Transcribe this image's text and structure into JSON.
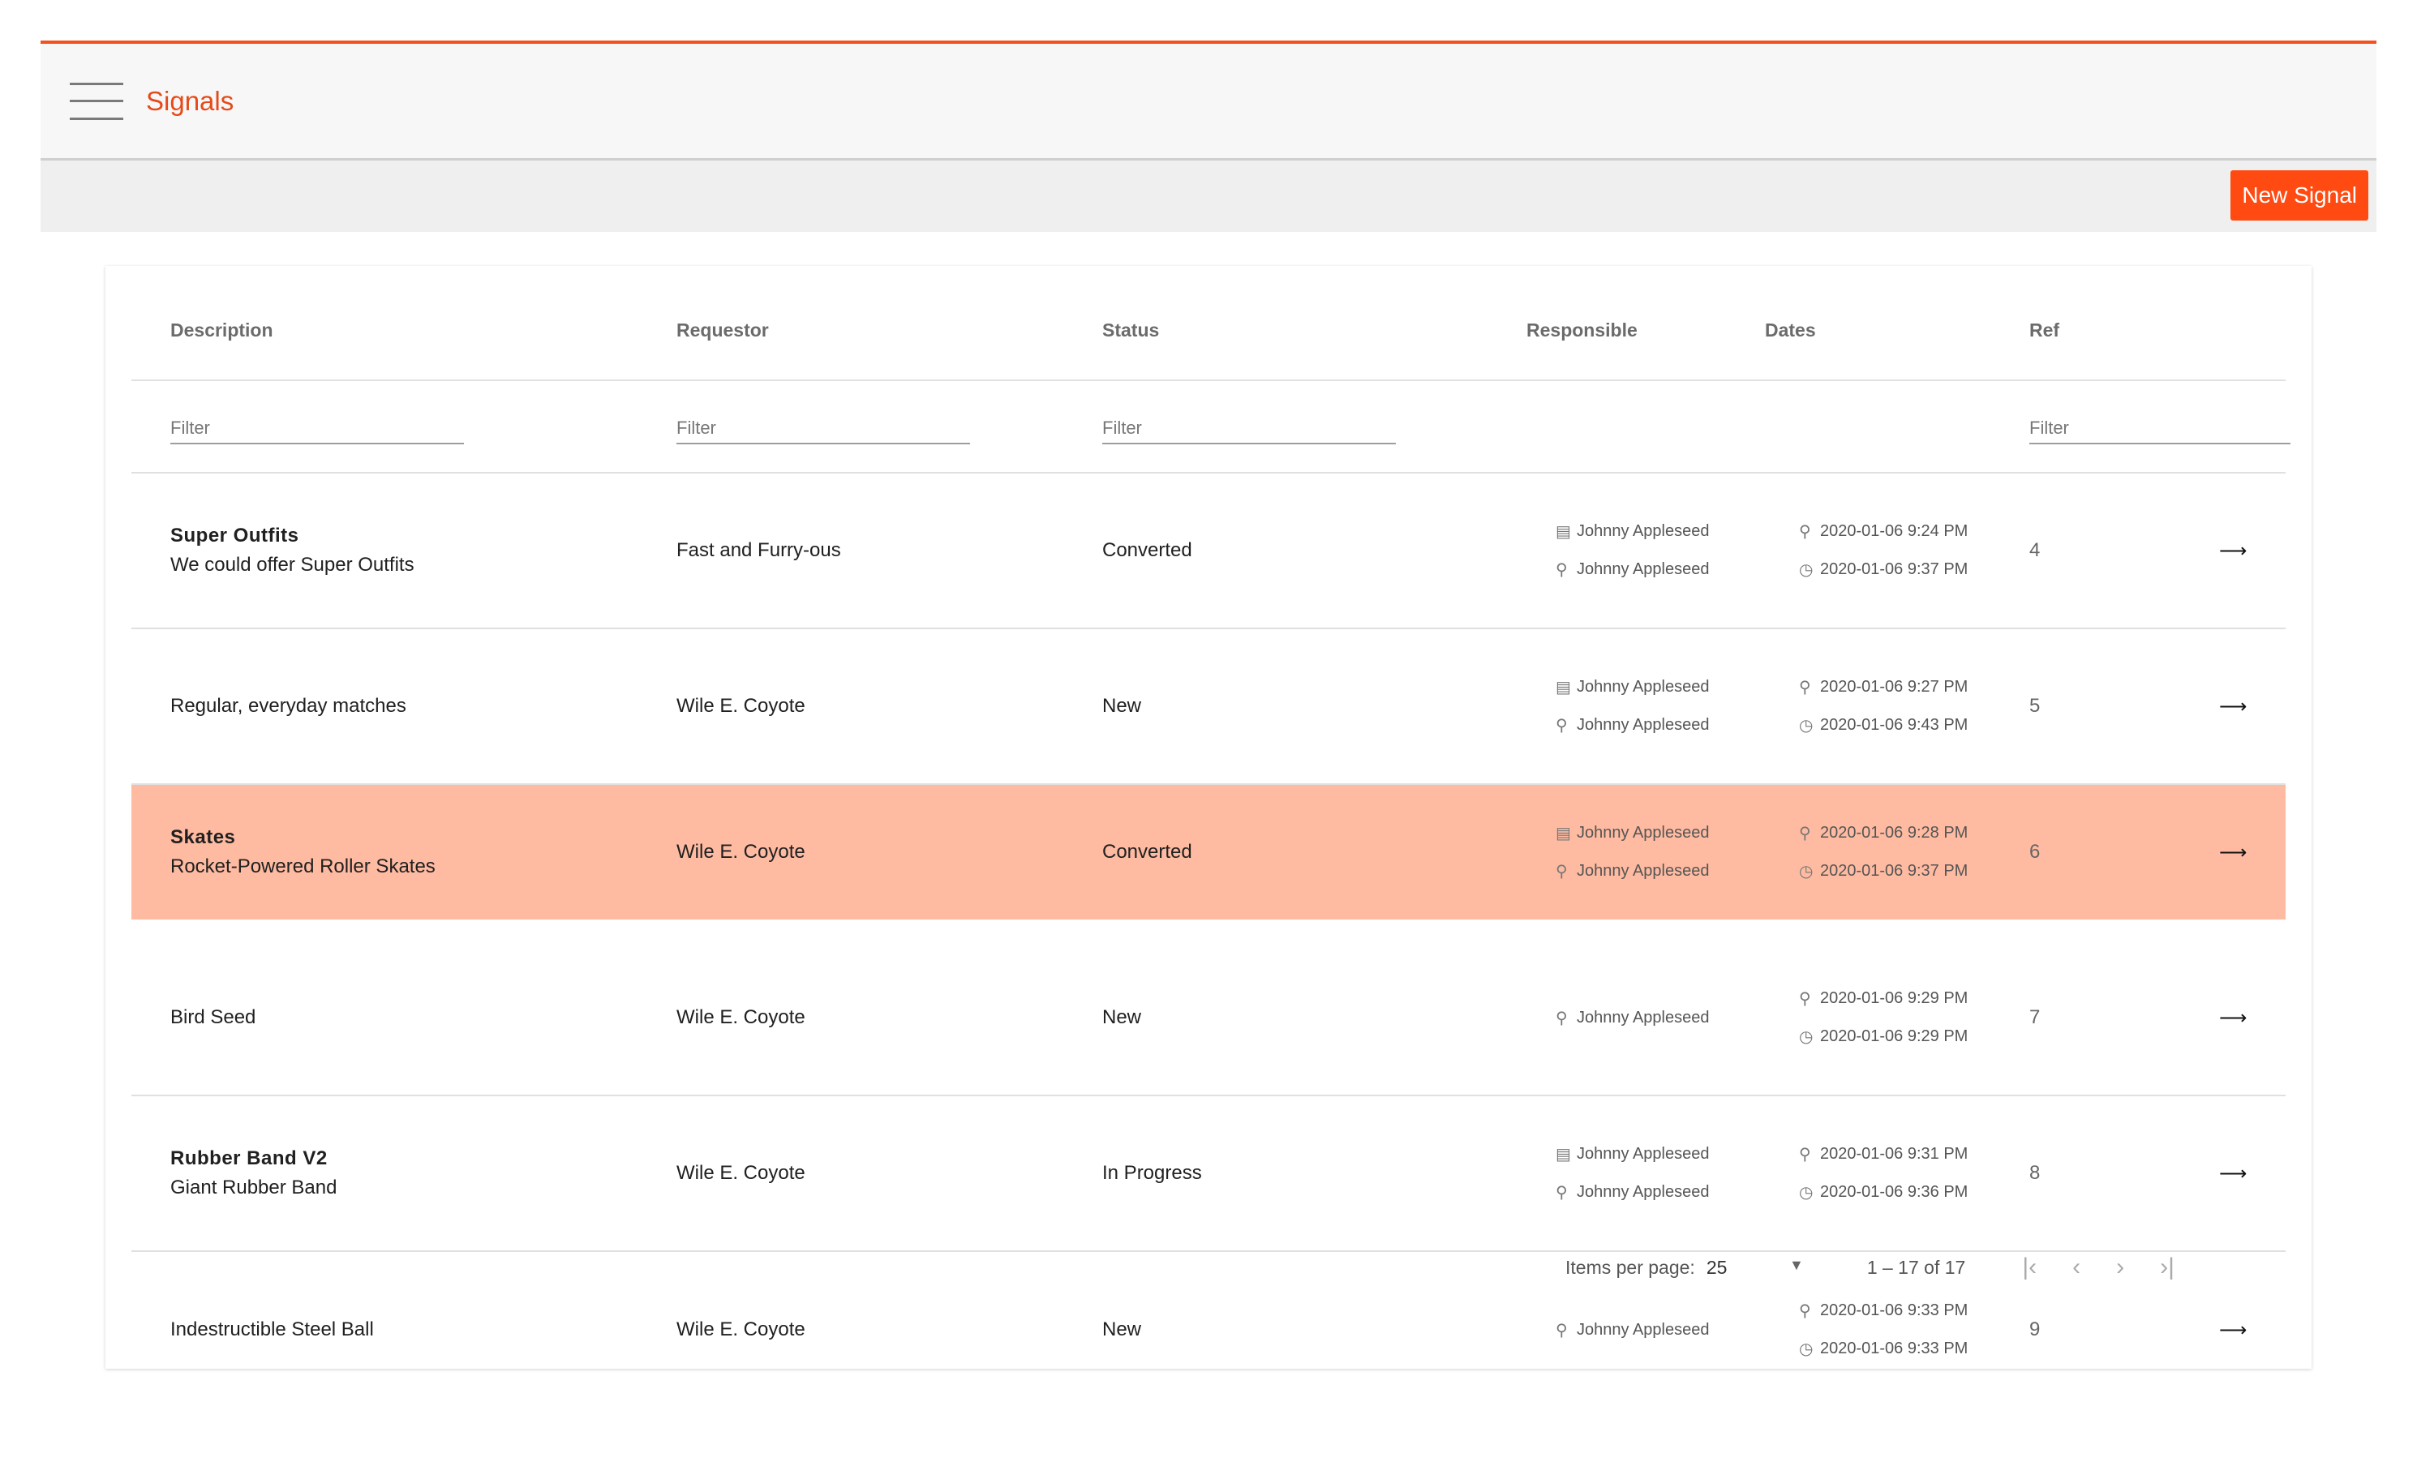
{
  "app": {
    "title": "Signals"
  },
  "toolbar": {
    "new_label": "New Signal"
  },
  "table": {
    "headers": [
      "Description",
      "Requestor",
      "Status",
      "Responsible",
      "Dates",
      "Ref"
    ],
    "filter_placeholder": "Filter",
    "rows": [
      {
        "title": "Super Outfits",
        "subtitle": "We could offer Super Outfits",
        "requestor": "Fast and Furry-ous",
        "status": "Converted",
        "owner": "Johnny Appleseed",
        "assignee": "Johnny Appleseed",
        "created": "2020-01-06 9:24 PM",
        "updated": "2020-01-06 9:37 PM",
        "ref": "4"
      },
      {
        "title": "",
        "subtitle": "Regular, everyday matches",
        "requestor": "Wile E. Coyote",
        "status": "New",
        "owner": "Johnny Appleseed",
        "assignee": "Johnny Appleseed",
        "created": "2020-01-06 9:27 PM",
        "updated": "2020-01-06 9:43 PM",
        "ref": "5"
      },
      {
        "title": "Skates",
        "subtitle": "Rocket-Powered Roller Skates",
        "requestor": "Wile E. Coyote",
        "status": "Converted",
        "owner": "Johnny Appleseed",
        "assignee": "Johnny Appleseed",
        "created": "2020-01-06 9:28 PM",
        "updated": "2020-01-06 9:37 PM",
        "ref": "6"
      },
      {
        "title": "",
        "subtitle": "Bird Seed",
        "requestor": "Wile E. Coyote",
        "status": "New",
        "owner": "",
        "assignee": "Johnny Appleseed",
        "created": "2020-01-06 9:29 PM",
        "updated": "2020-01-06 9:29 PM",
        "ref": "7"
      },
      {
        "title": "Rubber Band V2",
        "subtitle": "Giant Rubber Band",
        "requestor": "Wile E. Coyote",
        "status": "In Progress",
        "owner": "Johnny Appleseed",
        "assignee": "Johnny Appleseed",
        "created": "2020-01-06 9:31 PM",
        "updated": "2020-01-06 9:36 PM",
        "ref": "8"
      },
      {
        "title": "",
        "subtitle": "Indestructible Steel Ball",
        "requestor": "Wile E. Coyote",
        "status": "New",
        "owner": "",
        "assignee": "Johnny Appleseed",
        "created": "2020-01-06 9:33 PM",
        "updated": "2020-01-06 9:33 PM",
        "ref": "9"
      }
    ]
  },
  "paginator": {
    "label": "Items per page:",
    "page_size": "25",
    "range": "1 – 17 of 17"
  },
  "icons": {
    "menu": "hamburger-icon",
    "owner": "clipboard-icon",
    "assignee": "wrench-icon",
    "created": "wrench-icon",
    "updated": "clock-icon",
    "open": "arrow-right-icon"
  },
  "colors": {
    "accent": "#ff4a12",
    "highlight": "#ffbba1"
  }
}
